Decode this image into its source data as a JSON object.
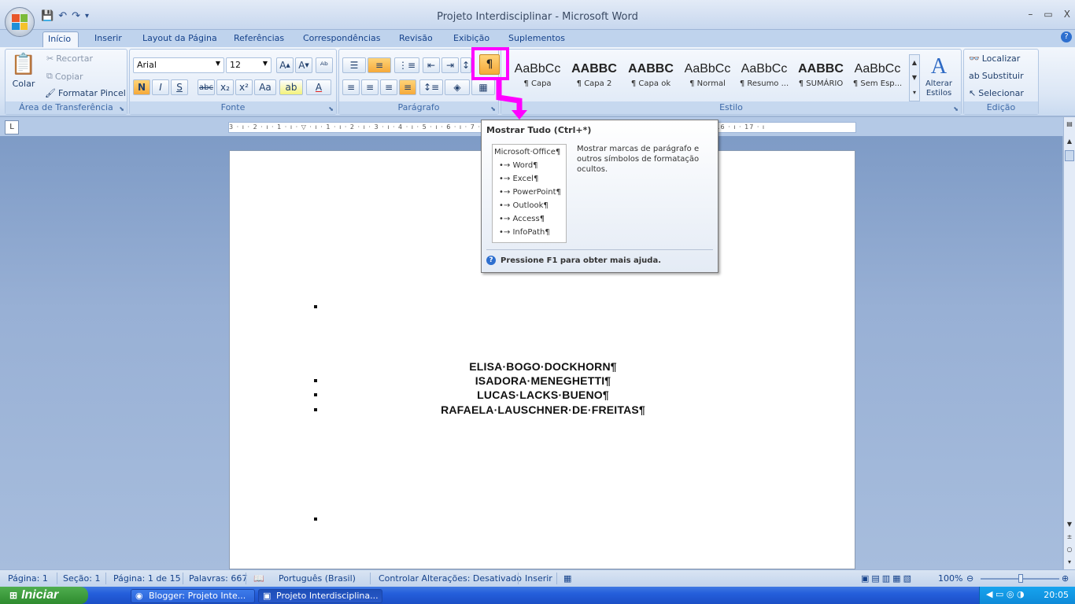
{
  "window": {
    "title": "Projeto Interdisciplinar - Microsoft Word",
    "minimize": "–",
    "restore": "▭",
    "close": "X"
  },
  "tabs": [
    "Início",
    "Inserir",
    "Layout da Página",
    "Referências",
    "Correspondências",
    "Revisão",
    "Exibição",
    "Suplementos"
  ],
  "clipboard": {
    "paste": "Colar",
    "cut": "Recortar",
    "copy": "Copiar",
    "format_painter": "Formatar Pincel",
    "label": "Área de Transferência"
  },
  "font": {
    "name": "Arial",
    "size": "12",
    "label": "Fonte",
    "bold": "N",
    "italic": "I",
    "underline": "S",
    "strike": "abc",
    "sub": "x₂",
    "sup": "x²",
    "case": "Aa"
  },
  "paragraph": {
    "label": "Parágrafo",
    "show_all": "¶"
  },
  "styles": {
    "label": "Estilo",
    "items": [
      {
        "sample": "AaBbCc",
        "name": "¶ Capa"
      },
      {
        "sample": "AABBC",
        "name": "¶ Capa 2"
      },
      {
        "sample": "AABBC",
        "name": "¶ Capa ok"
      },
      {
        "sample": "AaBbCc",
        "name": "¶ Normal"
      },
      {
        "sample": "AaBbCc",
        "name": "¶ Resumo ..."
      },
      {
        "sample": "AABBC",
        "name": "¶ SUMÁRIO"
      },
      {
        "sample": "AaBbCc",
        "name": "¶ Sem Esp..."
      }
    ],
    "change_styles": "Alterar Estilos"
  },
  "editing": {
    "label": "Edição",
    "find": "Localizar",
    "replace": "Substituir",
    "select": "Selecionar"
  },
  "ruler": {
    "text": "3 · ı · 2 · ı · 1 · ı · ▽ · ı · 1 · ı · 2 · ı · 3 · ı · 4 · ı · 5 · ı · 6 · ı · 7 · ı · 8 · ı · 9 · ı · 10 · ı · 11 · ı · 12 · ı · 13 · ı · 14 · ı · 15 · ı · 16 · ı · 17 · ı"
  },
  "tooltip": {
    "title": "Mostrar Tudo (Ctrl+*)",
    "example": [
      "Microsoft·Office¶",
      "Word¶",
      "Excel¶",
      "PowerPoint¶",
      "Outlook¶",
      "Access¶",
      "InfoPath¶"
    ],
    "description": "Mostrar marcas de parágrafo e outros símbolos de formatação ocultos.",
    "help": "Pressione F1 para obter mais ajuda."
  },
  "document": {
    "names": [
      "ELISA·BOGO·DOCKHORN¶",
      "ISADORA·MENEGHETTI¶",
      "LUCAS·LACKS·BUENO¶",
      "RAFAELA·LAUSCHNER·DE·FREITAS¶"
    ]
  },
  "status": {
    "page": "Página: 1",
    "section": "Seção: 1",
    "page_of": "Página: 1 de 15",
    "words": "Palavras: 667",
    "language": "Português (Brasil)",
    "track": "Controlar Alterações: Desativado",
    "insert": "Inserir",
    "zoom": "100%"
  },
  "taskbar": {
    "start": "Iniciar",
    "tasks": [
      "Blogger: Projeto Inte...",
      "Projeto Interdisciplina..."
    ],
    "clock": "20:05"
  },
  "colors": {
    "accent": "#ff00ff",
    "ribbon": "#dbe6f5",
    "taskbar": "#245edb"
  }
}
